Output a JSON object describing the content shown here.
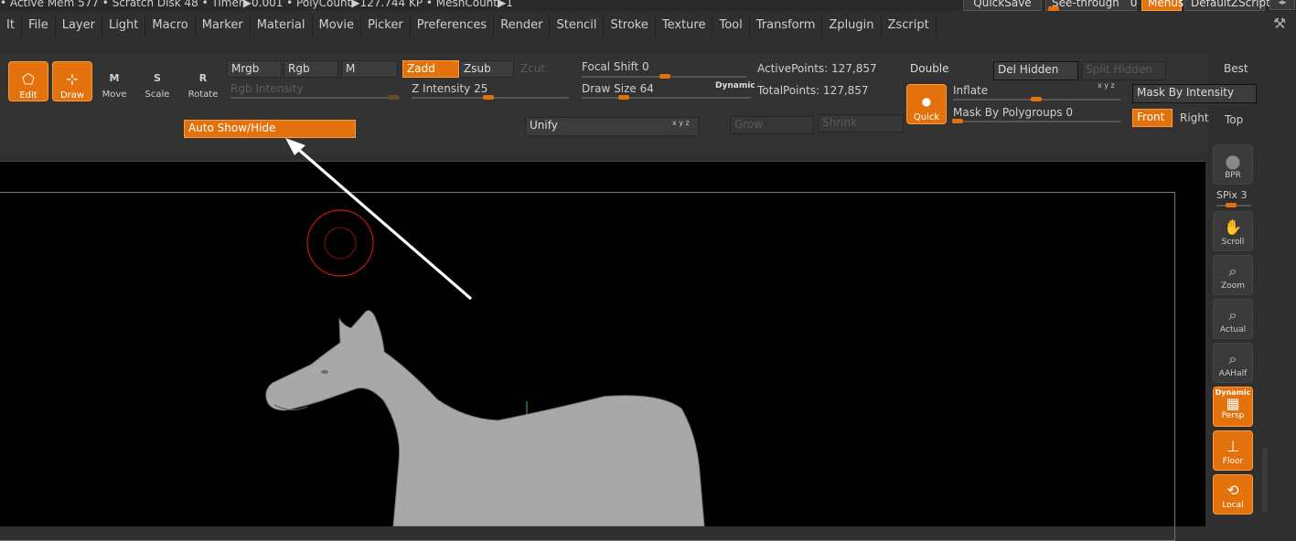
{
  "status_bar": {
    "text": "• Active Mem 577 • Scratch Disk 48 •  Timer▶0.001 • PolyCount▶127.744 KP  • MeshCount▶1"
  },
  "top_buttons": {
    "quicksave": "QuickSave",
    "see_through": "See-through",
    "see_through_value": "0",
    "menus": "Menus",
    "defaultzscript": "DefaultZScript"
  },
  "menubar": {
    "items": [
      "It",
      "File",
      "Layer",
      "Light",
      "Macro",
      "Marker",
      "Material",
      "Movie",
      "Picker",
      "Preferences",
      "Render",
      "Stencil",
      "Stroke",
      "Texture",
      "Tool",
      "Transform",
      "Zplugin",
      "Zscript"
    ]
  },
  "tools": {
    "edit": "Edit",
    "draw": "Draw",
    "move": "Move",
    "scale": "Scale",
    "rotate": "Rotate"
  },
  "color_modes": {
    "mrgb": "Mrgb",
    "rgb": "Rgb",
    "m": "M",
    "zadd": "Zadd",
    "zsub": "Zsub",
    "zcut": "Zcut"
  },
  "sliders": {
    "rgb_intensity_label": "Rgb Intensity",
    "z_intensity_label": "Z Intensity",
    "z_intensity_value": "25",
    "focal_shift_label": "Focal Shift",
    "focal_shift_value": "0",
    "draw_size_label": "Draw Size",
    "draw_size_value": "64",
    "dynamic": "Dynamic"
  },
  "stats": {
    "active_points": "ActivePoints: 127,857",
    "total_points": "TotalPoints: 127,857"
  },
  "auto_show_hide": "Auto Show/Hide",
  "unify": "Unify",
  "grow": "Grow",
  "shrink": "Shrink",
  "xyz_label": "x y z",
  "visibility": {
    "double": "Double",
    "del_hidden": "Del Hidden",
    "split_hidden": "Split Hidden"
  },
  "mask": {
    "quick": "Quick",
    "inflate": "Inflate",
    "mask_by_polygroups": "Mask By Polygroups",
    "mask_by_polygroups_value": "0",
    "mask_by_intensity": "Mask By Intensity"
  },
  "views": {
    "best": "Best",
    "front": "Front",
    "right": "Right",
    "top": "Top"
  },
  "sidebar": {
    "bpr": "BPR",
    "spix": "SPix",
    "spix_value": "3",
    "scroll": "Scroll",
    "zoom": "Zoom",
    "actual": "Actual",
    "aahalf": "AAHalf",
    "dynamic": "Dynamic",
    "persp": "Persp",
    "floor": "Floor",
    "local": "Local"
  },
  "colors": {
    "accent": "#e3720d",
    "panel": "#333333",
    "viewport": "#000000"
  }
}
